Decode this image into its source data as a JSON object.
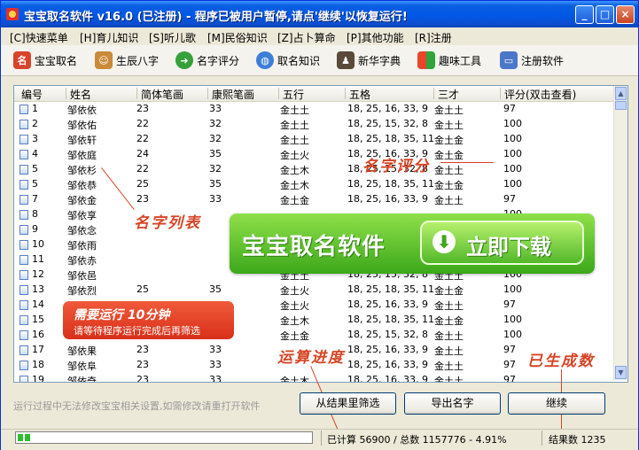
{
  "window": {
    "title": "宝宝取名软件  v16.0 (已注册) - 程序已被用户暂停,请点'继续'以恢复运行!",
    "controls": {
      "minimize": "_",
      "maximize": "□",
      "close": "×"
    }
  },
  "menu": [
    "[C]快速菜单",
    "[H]育儿知识",
    "[S]听儿歌",
    "[M]民俗知识",
    "[Z]占卜算命",
    "[P]其他功能",
    "[R]注册"
  ],
  "toolbar": [
    {
      "label": "宝宝取名",
      "icon": "baby-name-icon",
      "color": "#d8432b"
    },
    {
      "label": "生辰八字",
      "icon": "people-icon",
      "color": "#c98a3a"
    },
    {
      "label": "名字评分",
      "icon": "arrow-right-icon",
      "color": "#36a03a"
    },
    {
      "label": "取名知识",
      "icon": "globe-icon",
      "color": "#3d7fd6"
    },
    {
      "label": "新华字典",
      "icon": "scholar-icon",
      "color": "#5a4a3a"
    },
    {
      "label": "趣味工具",
      "icon": "windows-flag-icon",
      "color": "#e8a21e"
    },
    {
      "label": "注册软件",
      "icon": "monitor-icon",
      "color": "#4b77c9"
    }
  ],
  "table": {
    "columns": [
      "编号",
      "姓名",
      "简体笔画",
      "康熙笔画",
      "五行",
      "五格",
      "三才",
      "评分(双击查看)"
    ],
    "rows": [
      [
        "1",
        "邹依依",
        "23",
        "33",
        "金土土",
        "18, 25, 16, 33, 9",
        "金土土",
        "97"
      ],
      [
        "2",
        "邹依佑",
        "22",
        "32",
        "金土土",
        "18, 25, 15, 32, 8",
        "金土土",
        "100"
      ],
      [
        "3",
        "邹依轩",
        "22",
        "32",
        "金土土",
        "18, 25, 18, 35, 11",
        "金土金",
        "100"
      ],
      [
        "4",
        "邹依庭",
        "24",
        "35",
        "金土火",
        "18, 25, 16, 33, 9",
        "金土金",
        "100"
      ],
      [
        "5",
        "邹依杉",
        "22",
        "32",
        "金土木",
        "18, 25, 15, 32, 8",
        "金土土",
        "100"
      ],
      [
        "5",
        "邹依恭",
        "25",
        "35",
        "金土木",
        "18, 25, 18, 35, 11",
        "金土金",
        "100"
      ],
      [
        "7",
        "邹依金",
        "23",
        "33",
        "金土金",
        "18, 25, 16, 33, 9",
        "金土土",
        "97"
      ],
      [
        "8",
        "邹依享",
        "",
        "",
        "",
        "",
        "",
        "100"
      ],
      [
        "9",
        "邹依念",
        "",
        "",
        "",
        "",
        "",
        "100"
      ],
      [
        "10",
        "邹依雨",
        "",
        "",
        "",
        "",
        "",
        "100"
      ],
      [
        "11",
        "邹依赤",
        "",
        "",
        "",
        "",
        "",
        "100"
      ],
      [
        "12",
        "邹依邑",
        "",
        "",
        "金土土",
        "18, 25, 15, 32, 8",
        "金土土",
        "100"
      ],
      [
        "13",
        "邹依烈",
        "25",
        "35",
        "金土火",
        "18, 25, 18, 35, 11",
        "金土金",
        "100"
      ],
      [
        "14",
        "",
        "",
        "",
        "金土火",
        "18, 25, 16, 33, 9",
        "金土土",
        "97"
      ],
      [
        "15",
        "",
        "",
        "",
        "金土木",
        "18, 25, 18, 35, 11",
        "金土金",
        "100"
      ],
      [
        "16",
        "",
        "",
        "",
        "金土金",
        "18, 25, 15, 32, 8",
        "金土土",
        "100"
      ],
      [
        "17",
        "邹依果",
        "23",
        "33",
        "",
        "18, 25, 16, 33, 9",
        "金土土",
        "97"
      ],
      [
        "18",
        "邹依阜",
        "23",
        "33",
        "",
        "18, 25, 16, 33, 9",
        "金土土",
        "97"
      ],
      [
        "19",
        "邹依奇",
        "23",
        "33",
        "金土木",
        "18, 25, 16, 33, 9",
        "金土土",
        "97"
      ]
    ]
  },
  "promo": {
    "banner_title": "宝宝取名软件",
    "download_label": "立即下载",
    "runtime_title": "需要运行 10分钟",
    "runtime_sub": "请等待程序运行完成后再筛选"
  },
  "annotations": {
    "name_score": "名字评分",
    "name_list": "名字列表",
    "progress": "运算进度",
    "generated_count": "已生成数"
  },
  "hint": "运行过程中无法修改宝宝相关设置,如需修改请重打开软件",
  "buttons": {
    "filter": "从结果里筛选",
    "export": "导出名字",
    "continue": "继续"
  },
  "status": {
    "progress_fraction": 0.0491,
    "computed": "已计算 56900 / 总数 1157776 - 4.91%",
    "results": "结果数 1235"
  }
}
